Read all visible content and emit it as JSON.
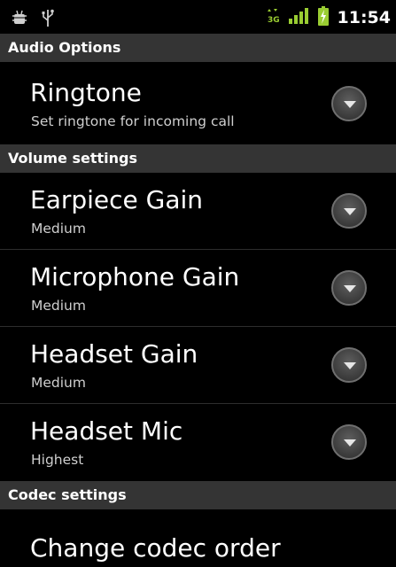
{
  "status_bar": {
    "time": "11:54",
    "network_label": "3G",
    "icons": [
      "android-bug-icon",
      "usb-icon",
      "data-3g-icon",
      "signal-strength-icon",
      "battery-charging-icon"
    ]
  },
  "sections": {
    "audio": "Audio Options",
    "volume": "Volume settings",
    "codec": "Codec settings"
  },
  "items": {
    "ringtone": {
      "title": "Ringtone",
      "summary": "Set ringtone for incoming call"
    },
    "earpiece": {
      "title": "Earpiece Gain",
      "summary": "Medium"
    },
    "microphone": {
      "title": "Microphone Gain",
      "summary": "Medium"
    },
    "headset_gain": {
      "title": "Headset Gain",
      "summary": "Medium"
    },
    "headset_mic": {
      "title": "Headset Mic",
      "summary": "Highest"
    },
    "codec_order": {
      "title": "Change codec order"
    }
  },
  "colors": {
    "background": "#000000",
    "section_header": "#343434",
    "signal_green": "#9acd32"
  }
}
